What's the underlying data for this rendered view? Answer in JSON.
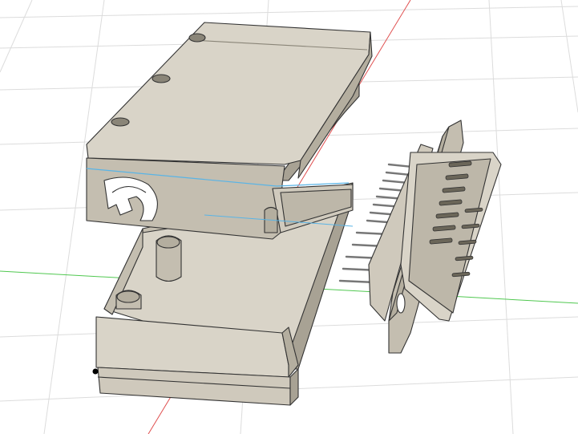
{
  "viewport": {
    "background": "#ffffff",
    "grid_color": "#dcdcdc",
    "axis_x_color": "#e05050",
    "axis_y_color": "#50c850",
    "body_color": "#d9d4c8",
    "body_shade": "#c4beb0",
    "body_dark": "#a8a294",
    "edge_color": "#333333",
    "highlight_edge": "#59b4e6",
    "pin_color": "#c8c8c8"
  }
}
